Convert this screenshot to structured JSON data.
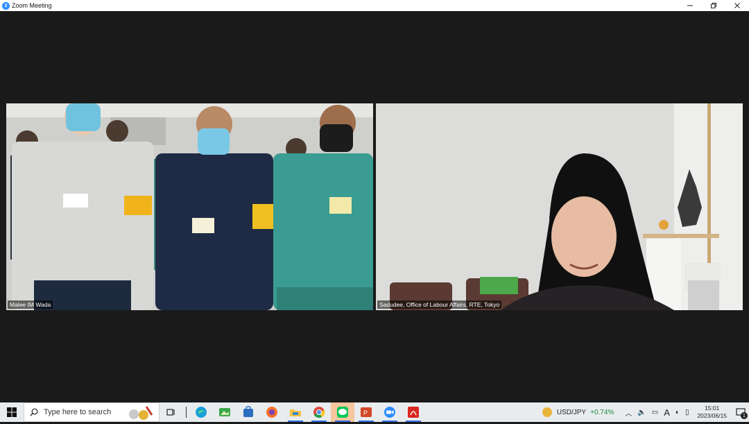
{
  "window": {
    "title": "Zoom Meeting",
    "app_icon": "zoom-icon",
    "controls": [
      "minimize-icon",
      "restore-icon",
      "close-icon"
    ]
  },
  "participants": [
    {
      "name": "Malee IM Wada"
    },
    {
      "name": "Sadudee, Office of Labour Affairs, RTE, Tokyo"
    }
  ],
  "taskbar": {
    "search_placeholder": "Type here to search",
    "pinned_icons": [
      "task-view-icon",
      "edge-icon",
      "photos-icon",
      "store-icon",
      "firefox-icon",
      "file-explorer-icon",
      "chrome-icon",
      "line-icon",
      "powerpoint-icon",
      "zoom-icon",
      "acrobat-icon"
    ],
    "ticker": {
      "symbol": "USD/JPY",
      "change": "+0.74%"
    },
    "clock": {
      "time": "15:01",
      "date": "2023/06/15"
    },
    "notification_count": "1",
    "input_indicator": "A"
  },
  "colors": {
    "meeting_bg": "#1a1a1a",
    "accent": "#2d8cff",
    "ticker_up": "#1b8a3a"
  }
}
